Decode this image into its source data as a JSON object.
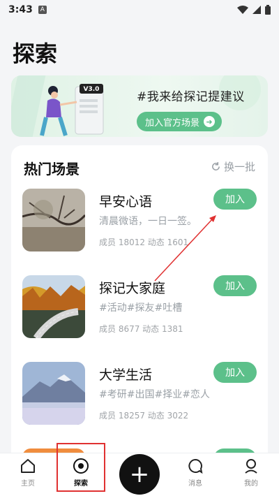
{
  "status": {
    "time": "3:43",
    "badge": "A"
  },
  "page": {
    "title": "探索"
  },
  "banner": {
    "version": "V3.0",
    "text": "#我来给探记提建议",
    "button": "加入官方场景"
  },
  "hot": {
    "title": "热门场景",
    "refresh": "换一批",
    "scenes": [
      {
        "name": "早安心语",
        "desc": "清晨微语，一日一签。",
        "stats": "成员 18012  动态 1601",
        "join": "加入"
      },
      {
        "name": "探记大家庭",
        "desc": "#活动#探友#吐槽",
        "stats": "成员 8677  动态 1381",
        "join": "加入"
      },
      {
        "name": "大学生活",
        "desc": "#考研#出国#择业#恋人",
        "stats": "成员 18257  动态 3022",
        "join": "加入"
      }
    ]
  },
  "tabs": [
    {
      "label": "主页",
      "icon": "home-icon"
    },
    {
      "label": "探索",
      "icon": "compass-icon"
    },
    {
      "label": "",
      "icon": "plus-icon"
    },
    {
      "label": "消息",
      "icon": "message-icon"
    },
    {
      "label": "我的",
      "icon": "profile-icon"
    }
  ],
  "colors": {
    "accent": "#5cc08a",
    "annotation": "#e03131"
  }
}
